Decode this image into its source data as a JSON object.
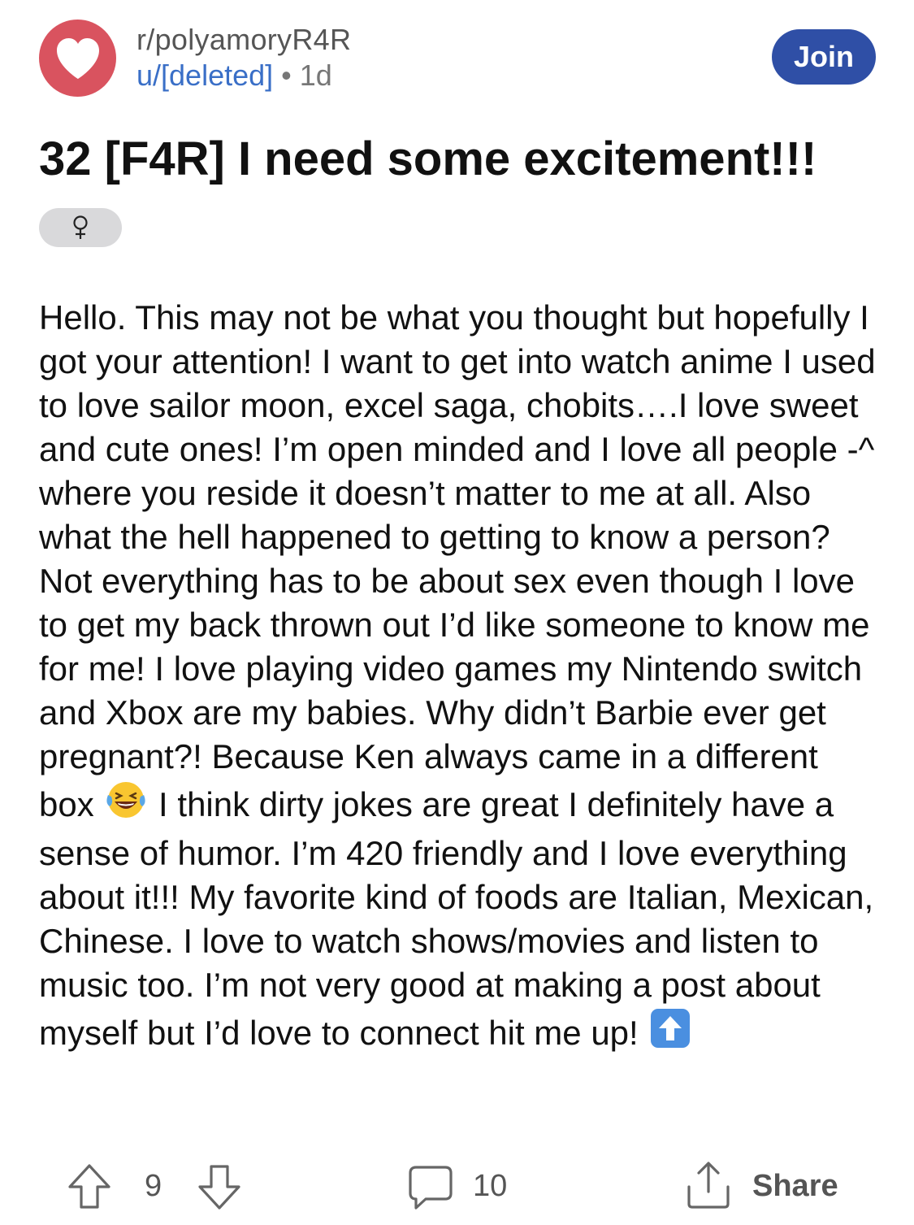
{
  "header": {
    "subreddit": "r/polyamoryR4R",
    "username": "u/[deleted]",
    "separator": "•",
    "age": "1d",
    "join_label": "Join"
  },
  "post": {
    "title": "32 [F4R] I need some excitement!!!",
    "flair_icon": "female-symbol-icon",
    "body_part1": "Hello. This may not be what you thought but hopefully I got your attention! I want to get into watch anime I used to love sailor moon, excel saga, chobits….I love sweet and cute ones! I’m open minded and I love all people ",
    "kaomoji": "-^",
    "body_part2": " where you reside it doesn’t matter to me at all. Also what the hell happened to getting to know a person? Not everything has to be about sex even though I love to get my back thrown out I’d like someone to know me for me! I love playing video games my Nintendo switch and Xbox are my babies. Why didn’t Barbie ever get pregnant?! Because Ken always came in a different box ",
    "emoji_laugh": "laughing-tears-emoji",
    "body_part3": " I think dirty jokes are great I definitely have a sense of humor. I’m 420 friendly and I love everything about it!!! My favorite kind of foods are Italian, Mexican, Chinese. I love to watch shows/movies and listen to music too. I’m not very good at making a post about myself but I’d love to connect hit me up! ",
    "emoji_up": "up-arrow-emoji"
  },
  "actions": {
    "vote_count": "9",
    "comment_count": "10",
    "share_label": "Share"
  },
  "colors": {
    "avatar": "#d9535f",
    "join_button": "#2f4fa6",
    "username": "#3a6fc7",
    "flair_bg": "#d9d9db"
  }
}
